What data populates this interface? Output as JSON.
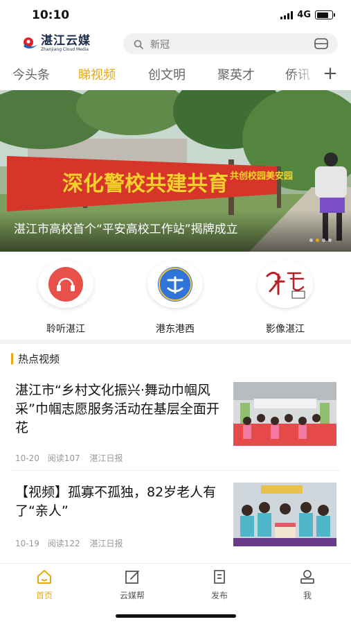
{
  "status_bar": {
    "time": "10:10",
    "network": "4G",
    "battery_level": 0.8
  },
  "header": {
    "logo_cn": "湛江云媒",
    "logo_en": "Zhanjiang Cloud Media",
    "search_placeholder": "新冠"
  },
  "tabs": [
    {
      "label": "今头条",
      "active": false
    },
    {
      "label": "睇视频",
      "active": true
    },
    {
      "label": "创文明",
      "active": false
    },
    {
      "label": "聚英才",
      "active": false
    },
    {
      "label": "侨讯",
      "active": false
    }
  ],
  "tabs_more_icon": "plus-icon",
  "banner": {
    "caption": "湛江市高校首个“平安高校工作站”揭牌成立",
    "scene_banner_text": "深化警校共建共育",
    "scene_banner_text_small": "共创校园美安园",
    "slide_count": 4,
    "active_slide": 1
  },
  "entries": [
    {
      "label": "聆听湛江",
      "icon": "listen-icon",
      "color": "#e8504a"
    },
    {
      "label": "港东港西",
      "icon": "harbor-icon",
      "color": "#2f74d9"
    },
    {
      "label": "影像湛江",
      "icon": "image-logo-icon",
      "color": "#b8202a"
    }
  ],
  "section": {
    "title": "热点视频"
  },
  "news": [
    {
      "title": "湛江市“乡村文化振兴·舞动巾帼风采”巾帼志愿服务活动在基层全面开花",
      "date": "10-20",
      "reads": "阅读107",
      "source": "湛江日报"
    },
    {
      "title": "【视频】孤寡不孤独，82岁老人有了“亲人”",
      "date": "10-19",
      "reads": "阅读122",
      "source": "湛江日报"
    }
  ],
  "bottom_nav": [
    {
      "label": "首页",
      "icon": "home-icon",
      "active": true
    },
    {
      "label": "云媒帮",
      "icon": "edit-icon",
      "active": false
    },
    {
      "label": "发布",
      "icon": "publish-icon",
      "active": false
    },
    {
      "label": "我",
      "icon": "user-icon",
      "active": false
    }
  ],
  "colors": {
    "accent": "#e8a913",
    "text": "#222222",
    "muted": "#999999"
  }
}
